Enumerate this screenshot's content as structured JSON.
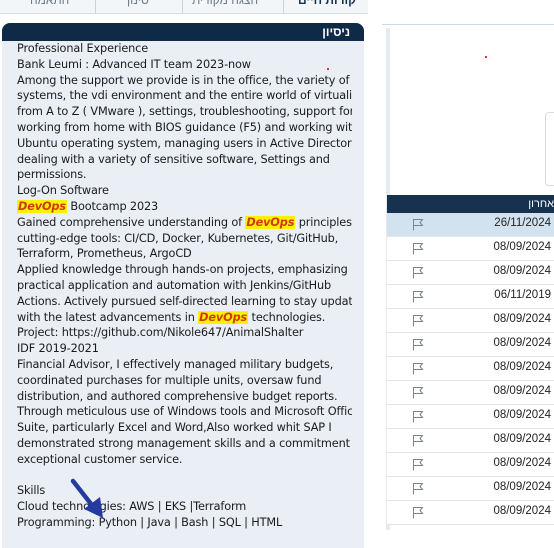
{
  "tabs": [
    {
      "label": "קורות חיים",
      "active": true
    },
    {
      "label": "הצגה מקורית",
      "active": false
    },
    {
      "label": "סינון",
      "active": false
    },
    {
      "label": "התאמה",
      "active": false
    }
  ],
  "experience_panel": {
    "title": "ניסיון",
    "lines": [
      [
        {
          "t": "Professional Experience"
        }
      ],
      [
        {
          "t": "Bank Leumi : Advanced IT team 2023-now"
        }
      ],
      [
        {
          "t": "Among the support we provide is in the office, the variety of bank"
        }
      ],
      [
        {
          "t": "systems, the vdi environment and the entire world of virtualization"
        }
      ],
      [
        {
          "t": "from A to Z ( VMware ), settings, troubleshooting, support for"
        }
      ],
      [
        {
          "t": "working from home with BIOS guidance (F5) and working with the"
        }
      ],
      [
        {
          "t": "Ubuntu operating system, managing users in Active Directory AD,"
        }
      ],
      [
        {
          "t": "dealing with a variety of sensitive software, Settings and"
        }
      ],
      [
        {
          "t": "permissions."
        }
      ],
      [
        {
          "t": "Log-On Software"
        }
      ],
      [
        {
          "t": "DevOps",
          "hl": true
        },
        {
          "t": " Bootcamp 2023"
        }
      ],
      [
        {
          "t": "Gained comprehensive understanding of "
        },
        {
          "t": "DevOps",
          "hl": true
        },
        {
          "t": " principles and"
        }
      ],
      [
        {
          "t": "cutting-edge tools: CI/CD, Docker, Kubernetes, Git/GitHub,"
        }
      ],
      [
        {
          "t": "Terraform, Prometheus, ArgoCD"
        }
      ],
      [
        {
          "t": "Applied knowledge through hands-on projects, emphasizing"
        }
      ],
      [
        {
          "t": "practical application and automation with Jenkins/GitHub"
        }
      ],
      [
        {
          "t": "Actions. Actively pursued self-directed learning to stay updated"
        }
      ],
      [
        {
          "t": "with the latest advancements in "
        },
        {
          "t": "DevOps",
          "hl": true
        },
        {
          "t": " technologies."
        }
      ],
      [
        {
          "t": "Project: https://github.com/Nikole647/AnimalShalter"
        }
      ],
      [
        {
          "t": "IDF 2019-2021"
        }
      ],
      [
        {
          "t": "Financial Advisor, I effectively managed military budgets,"
        }
      ],
      [
        {
          "t": "coordinated purchases for multiple units, oversaw fund"
        }
      ],
      [
        {
          "t": "distribution, and authored comprehensive budget reports."
        }
      ],
      [
        {
          "t": "Through meticulous use of Windows tools and Microsoft Office"
        }
      ],
      [
        {
          "t": "Suite, particularly Excel and Word,Also worked whit SAP I"
        }
      ],
      [
        {
          "t": "demonstrated strong management skills and a commitment to"
        }
      ],
      [
        {
          "t": "exceptional customer service."
        }
      ],
      [],
      [
        {
          "t": "Skills"
        }
      ],
      [
        {
          "t": "Cloud technologies: AWS | EKS |Terraform"
        }
      ],
      [
        {
          "t": "Programming: Python | Java | Bash | SQL | HTML"
        }
      ]
    ]
  },
  "colors": {
    "header_bg": "#0f2a46",
    "panel_bg": "#e9eff5",
    "highlight_bg": "#fff200",
    "highlight_text": "#d4380d",
    "arrow": "#243a9e",
    "selected_row": "#d3e2ef"
  },
  "annotation_icon": "pointer-arrow-icon",
  "results_table": {
    "header": "אחרון",
    "rows": [
      {
        "date": "26/11/2024",
        "selected": true,
        "icon": "flag-icon"
      },
      {
        "date": "08/09/2024",
        "selected": false,
        "icon": "flag-icon"
      },
      {
        "date": "08/09/2024",
        "selected": false,
        "icon": "flag-icon"
      },
      {
        "date": "06/11/2019",
        "selected": false,
        "icon": "flag-icon"
      },
      {
        "date": "08/09/2024",
        "selected": false,
        "icon": "flag-icon"
      },
      {
        "date": "08/09/2024",
        "selected": false,
        "icon": "flag-icon"
      },
      {
        "date": "08/09/2024",
        "selected": false,
        "icon": "flag-icon"
      },
      {
        "date": "08/09/2024",
        "selected": false,
        "icon": "flag-icon"
      },
      {
        "date": "08/09/2024",
        "selected": false,
        "icon": "flag-icon"
      },
      {
        "date": "08/09/2024",
        "selected": false,
        "icon": "flag-icon"
      },
      {
        "date": "08/09/2024",
        "selected": false,
        "icon": "flag-icon"
      },
      {
        "date": "08/09/2024",
        "selected": false,
        "icon": "flag-icon"
      },
      {
        "date": "08/09/2024",
        "selected": false,
        "icon": "flag-icon"
      }
    ]
  }
}
